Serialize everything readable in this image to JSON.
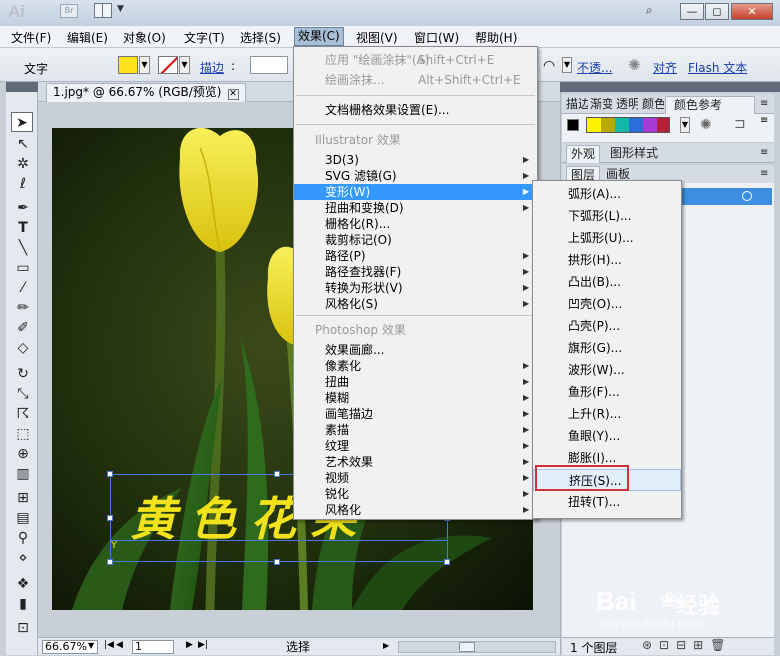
{
  "app": {
    "logo": "Ai",
    "bridge": "Br"
  },
  "window": {
    "minimize": "—",
    "restore": "◻",
    "close": "✕"
  },
  "menubar": [
    "文件(F)",
    "编辑(E)",
    "对象(O)",
    "文字(T)",
    "选择(S)",
    "效果(C)",
    "视图(V)",
    "窗口(W)",
    "帮助(H)"
  ],
  "control_bar": {
    "type_label": "文字",
    "stroke_label": "描边",
    "stroke_colon": ":",
    "opacity_label": "不透...",
    "align_label": "对齐",
    "flash_label": "Flash 文本",
    "fill_color": "#ffe21a"
  },
  "document": {
    "tab_title": "1.jpg* @ 66.67% (RGB/预览)",
    "close": "✕",
    "artwork_text": "黄色花朵",
    "cursor_glyph": "Y"
  },
  "status": {
    "zoom": "66.67%",
    "page": "1",
    "tool": "选择",
    "first": "|◀",
    "prev": "◀",
    "next": "▶",
    "last": "▶|"
  },
  "panels": {
    "top_tabs": [
      "描边",
      "渐变",
      "透明",
      "颜色",
      "颜色参考"
    ],
    "guide_colors": [
      "#fff200",
      "#b7a900",
      "#12b8a8",
      "#2a6fd9",
      "#a83ad6",
      "#b3203a"
    ],
    "appearance_tabs": [
      "外观",
      "图形样式"
    ],
    "layers_tabs": [
      "图层",
      "画板"
    ],
    "layers_count": "1 个图层"
  },
  "effect_menu": {
    "items": [
      {
        "label": "应用 \"绘画涂抹\"(A)",
        "shortcut": "Shift+Ctrl+E",
        "disabled": true
      },
      {
        "label": "绘画涂抹...",
        "shortcut": "Alt+Shift+Ctrl+E",
        "disabled": true
      },
      {
        "label": "文档栅格效果设置(E)..."
      },
      {
        "label": "Illustrator 效果",
        "header": true
      },
      {
        "label": "3D(3)",
        "submenu": true
      },
      {
        "label": "SVG 滤镜(G)",
        "submenu": true
      },
      {
        "label": "变形(W)",
        "submenu": true,
        "highlight": true
      },
      {
        "label": "扭曲和变换(D)",
        "submenu": true
      },
      {
        "label": "栅格化(R)..."
      },
      {
        "label": "裁剪标记(O)"
      },
      {
        "label": "路径(P)",
        "submenu": true
      },
      {
        "label": "路径查找器(F)",
        "submenu": true
      },
      {
        "label": "转换为形状(V)",
        "submenu": true
      },
      {
        "label": "风格化(S)",
        "submenu": true
      },
      {
        "label": "Photoshop 效果",
        "header": true
      },
      {
        "label": "效果画廊..."
      },
      {
        "label": "像素化",
        "submenu": true
      },
      {
        "label": "扭曲",
        "submenu": true
      },
      {
        "label": "模糊",
        "submenu": true
      },
      {
        "label": "画笔描边",
        "submenu": true
      },
      {
        "label": "素描",
        "submenu": true
      },
      {
        "label": "纹理",
        "submenu": true
      },
      {
        "label": "艺术效果",
        "submenu": true
      },
      {
        "label": "视频",
        "submenu": true
      },
      {
        "label": "锐化",
        "submenu": true
      },
      {
        "label": "风格化",
        "submenu": true
      }
    ]
  },
  "warp_menu": {
    "items": [
      "弧形(A)...",
      "下弧形(L)...",
      "上弧形(U)...",
      "拱形(H)...",
      "凸出(B)...",
      "凹壳(O)...",
      "凸壳(P)...",
      "旗形(G)...",
      "波形(W)...",
      "鱼形(F)...",
      "上升(R)...",
      "鱼眼(Y)...",
      "膨胀(I)...",
      "挤压(S)...",
      "扭转(T)..."
    ],
    "selected_index": 13
  },
  "watermark": {
    "brand": "Bai",
    "tail": "经验",
    "url": "jingyan.baidu.com"
  }
}
